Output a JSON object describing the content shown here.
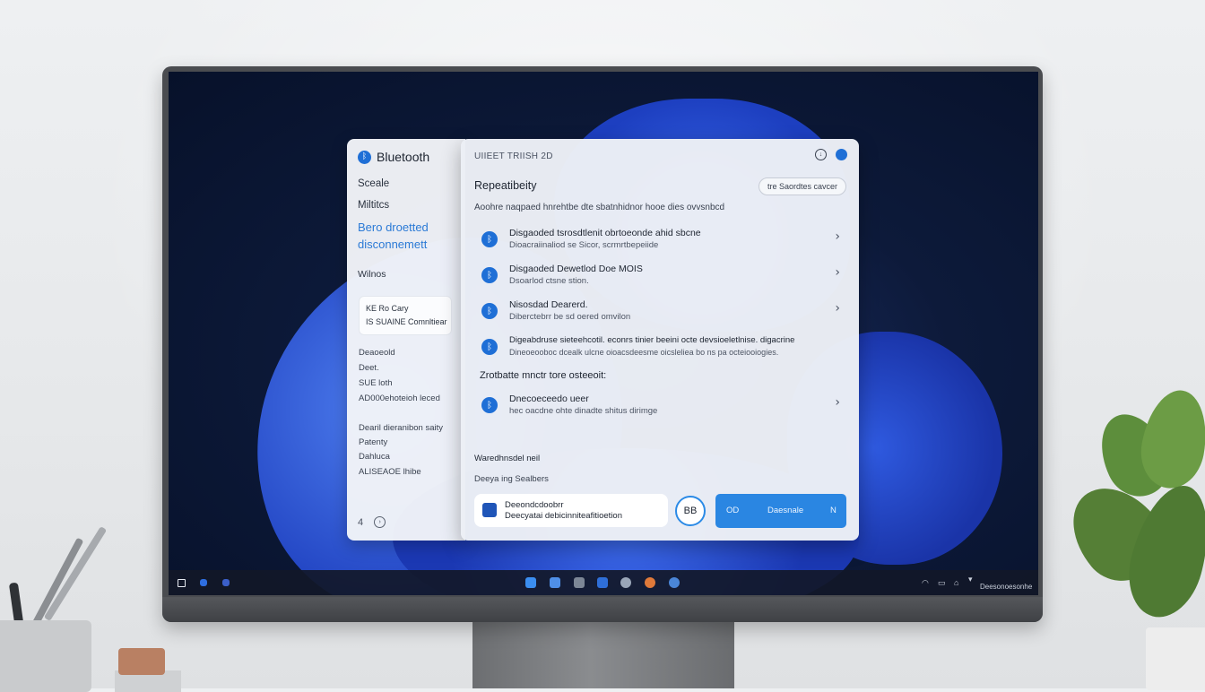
{
  "left_panel": {
    "title": "Bluetooth",
    "items": [
      "Sceale",
      "Miltitcs"
    ],
    "link_lines": [
      "Bero droetted",
      "disconnemett"
    ],
    "item_windows": "Wilnos",
    "card_lines": [
      "KE Ro Cary",
      "IS SUAINE Comnltiear"
    ],
    "group1": [
      "Deaoeold",
      "Deet.",
      "SUE loth",
      "AD000ehoteioh leced"
    ],
    "group2": [
      "Dearil dieranibon saity",
      "Patenty",
      "Dahluca",
      "ALISEAOE lhibe"
    ],
    "bottom_back": "4"
  },
  "main_panel": {
    "breadcrumb": "UIIEET TRIISH 2D",
    "heading": "Repeatibeity",
    "pill_label": "tre Saordtes cavcer",
    "description": "Aoohre naqpaed hnrehtbe dte sbatnhidnor hooe dies ovvsnbcd",
    "devices": [
      {
        "title": "Disgaoded tsrosdtlenit obrtoeonde ahid sbcne",
        "subtitle": "Dioacraiinaliod se Sicor, scrmrtbepeiide"
      },
      {
        "title": "Disgaoded Dewetlod Doe MOIS",
        "subtitle": "Dsoarlod ctsne stion."
      },
      {
        "title": "Nisosdad Dearerd.",
        "subtitle": "Diberctebrr be sd oered omvilon"
      },
      {
        "title": "Digeabdruse sieteehcotil. econrs tinier beeini octe devsioeletlnise. digacrine",
        "subtitle": "Dineoeooboc dcealk ulcne oioacsdeesme oicsleliea bo ns pa octeiooiogies."
      }
    ],
    "section_label": "Zrotbatte mnctr tore osteeoit:",
    "extra_device": {
      "title": "Dnecoeceedo ueer",
      "subtitle": "hec oacdne ohte dinadte shitus dirimge"
    },
    "footer_title": "Waredhnsdel neil",
    "footer_sub": "Deeya ing Sealbers",
    "card_line1": "Deeondcdoobrr",
    "card_line2": "Deecyatai debicinniteafitioetion",
    "ring_label": "BB",
    "button_left": "OD",
    "button_mid": "Daesnale",
    "button_right": "N"
  },
  "taskbar": {
    "tray_text": "Deesonoesonhe"
  },
  "icons": {
    "bluetooth": "bluetooth-icon",
    "chevron": "chevron-right-icon",
    "info": "info-icon",
    "status": "status-dot-icon"
  },
  "colors": {
    "accent": "#1f6fd6",
    "link": "#2b7ad6",
    "button": "#2a86e2"
  }
}
